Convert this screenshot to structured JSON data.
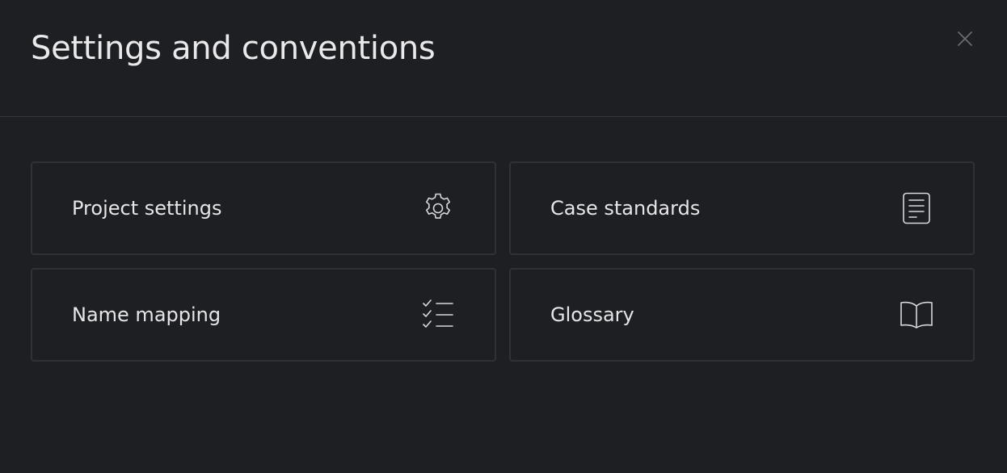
{
  "dialog": {
    "title": "Settings and conventions",
    "close_icon": "close-icon"
  },
  "cards": [
    {
      "label": "Project settings",
      "icon": "gear-icon"
    },
    {
      "label": "Case standards",
      "icon": "document-icon"
    },
    {
      "label": "Name mapping",
      "icon": "checklist-icon"
    },
    {
      "label": "Glossary",
      "icon": "book-icon"
    }
  ],
  "colors": {
    "background": "#1e1f23",
    "border": "#303136",
    "text": "#e6e6e8",
    "icon": "#d8d8da"
  }
}
